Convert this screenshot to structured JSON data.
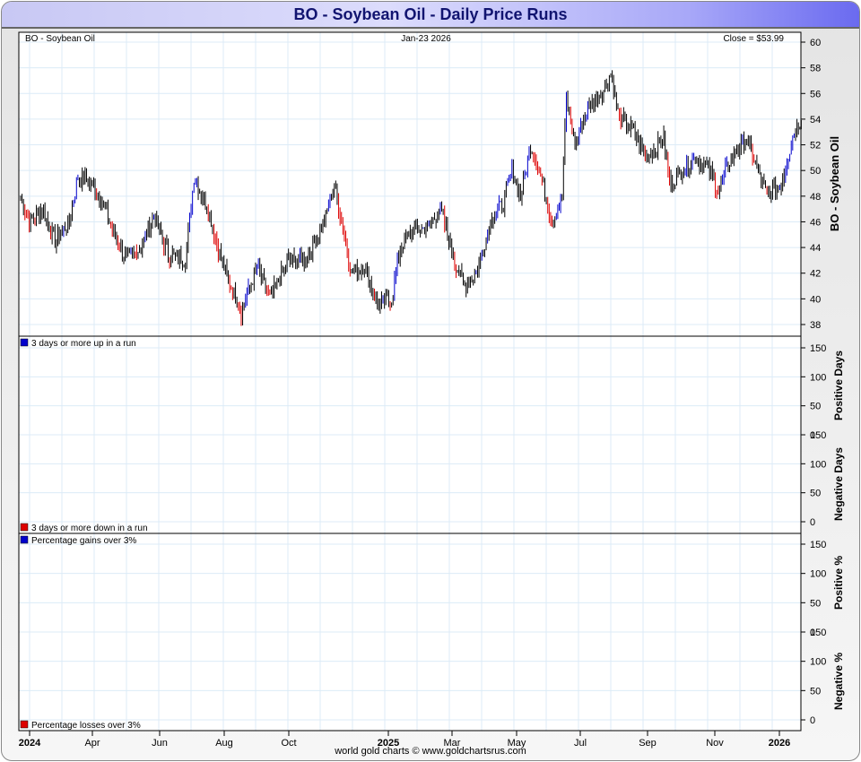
{
  "window": {
    "title": "BO  -  Soybean Oil - Daily Price Runs",
    "footer": "world gold charts © www.goldchartsrus.com"
  },
  "chart_data": {
    "type": "ohlc",
    "title": "BO  -  Soybean Oil - Daily Price Runs",
    "header_left": "BO  -  Soybean Oil",
    "header_center": "Jan-23  2026",
    "header_right": "Close = $53.99",
    "price_ylabel": "BO  -  Soybean Oil",
    "price_ylim": [
      37,
      61
    ],
    "price_ticks": [
      38,
      40,
      42,
      44,
      46,
      48,
      50,
      52,
      54,
      56,
      58,
      60
    ],
    "x_ticks": [
      "2024",
      "Apr",
      "Jun",
      "Aug",
      "Oct",
      "2025",
      "Mar",
      "May",
      "Jul",
      "Sep",
      "Nov",
      "2026"
    ],
    "colors": {
      "up_run": "#0000cc",
      "down_run": "#dd0000",
      "normal": "#000000"
    },
    "close_keypoints_trading_day_price": [
      [
        0,
        48
      ],
      [
        6,
        46
      ],
      [
        15,
        47
      ],
      [
        24,
        44.5
      ],
      [
        34,
        46
      ],
      [
        40,
        49.5
      ],
      [
        49,
        49
      ],
      [
        56,
        48
      ],
      [
        65,
        45
      ],
      [
        74,
        43
      ],
      [
        84,
        44
      ],
      [
        93,
        46.5
      ],
      [
        103,
        43.5
      ],
      [
        115,
        43
      ],
      [
        121,
        49.5
      ],
      [
        131,
        47
      ],
      [
        140,
        43
      ],
      [
        154,
        39
      ],
      [
        165,
        42.5
      ],
      [
        174,
        40
      ],
      [
        187,
        43
      ],
      [
        199,
        43
      ],
      [
        212,
        46
      ],
      [
        219,
        49
      ],
      [
        224,
        46
      ],
      [
        231,
        42
      ],
      [
        240,
        42.5
      ],
      [
        249,
        39.5
      ],
      [
        259,
        40
      ],
      [
        265,
        44
      ],
      [
        274,
        45.5
      ],
      [
        284,
        45.5
      ],
      [
        293,
        47
      ],
      [
        303,
        43
      ],
      [
        309,
        41
      ],
      [
        318,
        42
      ],
      [
        328,
        46
      ],
      [
        337,
        47.5
      ],
      [
        343,
        50
      ],
      [
        349,
        48
      ],
      [
        356,
        52
      ],
      [
        362,
        50
      ],
      [
        371,
        46
      ],
      [
        378,
        48
      ],
      [
        381,
        55.5
      ],
      [
        387,
        52
      ],
      [
        396,
        55
      ],
      [
        406,
        56
      ],
      [
        412,
        57.5
      ],
      [
        418,
        54
      ],
      [
        428,
        53
      ],
      [
        437,
        51
      ],
      [
        449,
        52.5
      ],
      [
        453,
        49
      ],
      [
        462,
        50
      ],
      [
        471,
        51
      ],
      [
        481,
        50
      ],
      [
        487,
        48.5
      ],
      [
        496,
        51
      ],
      [
        506,
        52.5
      ],
      [
        515,
        50
      ],
      [
        521,
        48
      ],
      [
        531,
        49
      ],
      [
        540,
        53
      ],
      [
        545,
        54
      ]
    ],
    "panes": [
      {
        "ylabel": "Positive Days",
        "legend": "3 days or more up in a run",
        "ticks": [
          0,
          50,
          100,
          150
        ],
        "color": "#0000cc"
      },
      {
        "ylabel": "Negative Days",
        "legend": "3 days or more down in a run",
        "ticks": [
          0,
          50,
          100,
          150
        ],
        "color": "#dd0000"
      },
      {
        "ylabel": "Positive %",
        "legend": "Percentage gains over 3%",
        "ticks": [
          0,
          50,
          100,
          150
        ],
        "color": "#0000cc"
      },
      {
        "ylabel": "Negative %",
        "legend": "Percentage losses over 3%",
        "ticks": [
          0,
          50,
          100,
          150
        ],
        "color": "#dd0000"
      }
    ]
  }
}
